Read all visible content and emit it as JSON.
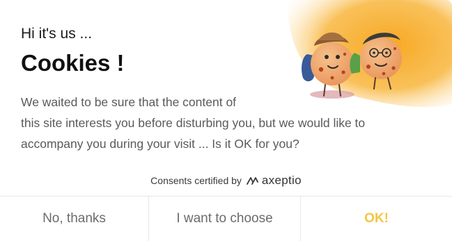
{
  "dialog": {
    "greeting": "Hi it's us ...",
    "title": "Cookies !",
    "message_lines": [
      "We waited to be sure that the content of",
      "this site interests you before disturbing you, but we would like to",
      "accompany you during your visit ... Is it OK for you?"
    ]
  },
  "certification": {
    "text": "Consents certified by",
    "brand_icon": "axeptio-logo-icon",
    "brand_name": "axeptio"
  },
  "buttons": {
    "decline_label": "No, thanks",
    "choose_label": "I want to choose",
    "accept_label": "OK!"
  },
  "colors": {
    "accent_yellow": "#f2c744",
    "illustration_orange": "#f7a823",
    "text_muted": "#5a5a5a"
  },
  "illustration": {
    "icon": "cookie-characters-illustration"
  }
}
